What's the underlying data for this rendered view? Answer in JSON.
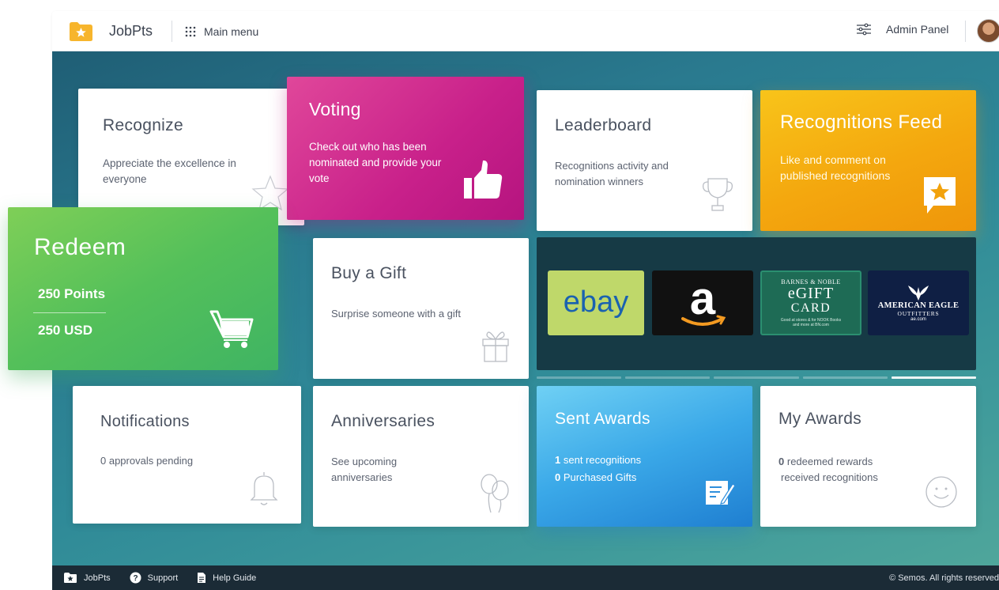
{
  "topbar": {
    "brand": "JobPts",
    "menu_label": "Main menu",
    "admin_label": "Admin Panel"
  },
  "tiles": {
    "recognize": {
      "title": "Recognize",
      "desc": "Appreciate the excellence in everyone",
      "icon": "star-outline-icon"
    },
    "voting": {
      "title": "Voting",
      "desc": "Check out who has been nominated and provide your vote",
      "icon": "thumbs-up-icon"
    },
    "leaderboard": {
      "title": "Leaderboard",
      "desc": "Recognitions activity and nomination winners",
      "icon": "trophy-icon"
    },
    "feed": {
      "title": "Recognitions Feed",
      "desc": "Like and comment on published recognitions",
      "icon": "star-chat-icon"
    },
    "redeem": {
      "title": "Redeem",
      "points": "250 Points",
      "usd": "250 USD",
      "icon": "cart-icon"
    },
    "gift": {
      "title": "Buy a Gift",
      "desc": "Surprise someone with a gift",
      "icon": "gift-icon"
    },
    "notifications": {
      "title": "Notifications",
      "desc": "0 approvals pending",
      "icon": "bell-icon"
    },
    "anniversaries": {
      "title": "Anniversaries",
      "desc": "See upcoming anniversaries",
      "icon": "balloons-icon"
    },
    "sent": {
      "title": "Sent Awards",
      "count1": "1",
      "line1": "sent recognitions",
      "count2": "0",
      "line2": "Purchased Gifts",
      "icon": "edit-note-icon"
    },
    "myawards": {
      "title": "My Awards",
      "count1": "0",
      "line1": "redeemed rewards",
      "line2": "received recognitions",
      "icon": "smiley-icon"
    }
  },
  "giftcards": [
    {
      "name": "ebay",
      "bg": "#bfd86a"
    },
    {
      "name": "a",
      "bg": "#111111"
    },
    {
      "name": "BARNES & NOBLE",
      "sub": "eGIFT",
      "sub2": "CARD",
      "fine": "Good at stores & for NOOK Books and more at BN.com",
      "bg": "#1e6b55"
    },
    {
      "name": "AMERICAN EAGLE",
      "sub": "OUTFITTERS",
      "fine": "ae.com",
      "bg": "#0f1f44"
    }
  ],
  "carousel_active_dot": 4,
  "footer": {
    "brand": "JobPts",
    "support": "Support",
    "help": "Help Guide",
    "copyright": "© Semos. All rights reserved"
  },
  "colors": {
    "voting": "#c8208a",
    "feed": "#f4a70e",
    "redeem": "#54c05a",
    "sent": "#3aa8e8",
    "accent": "#f7b52c"
  }
}
